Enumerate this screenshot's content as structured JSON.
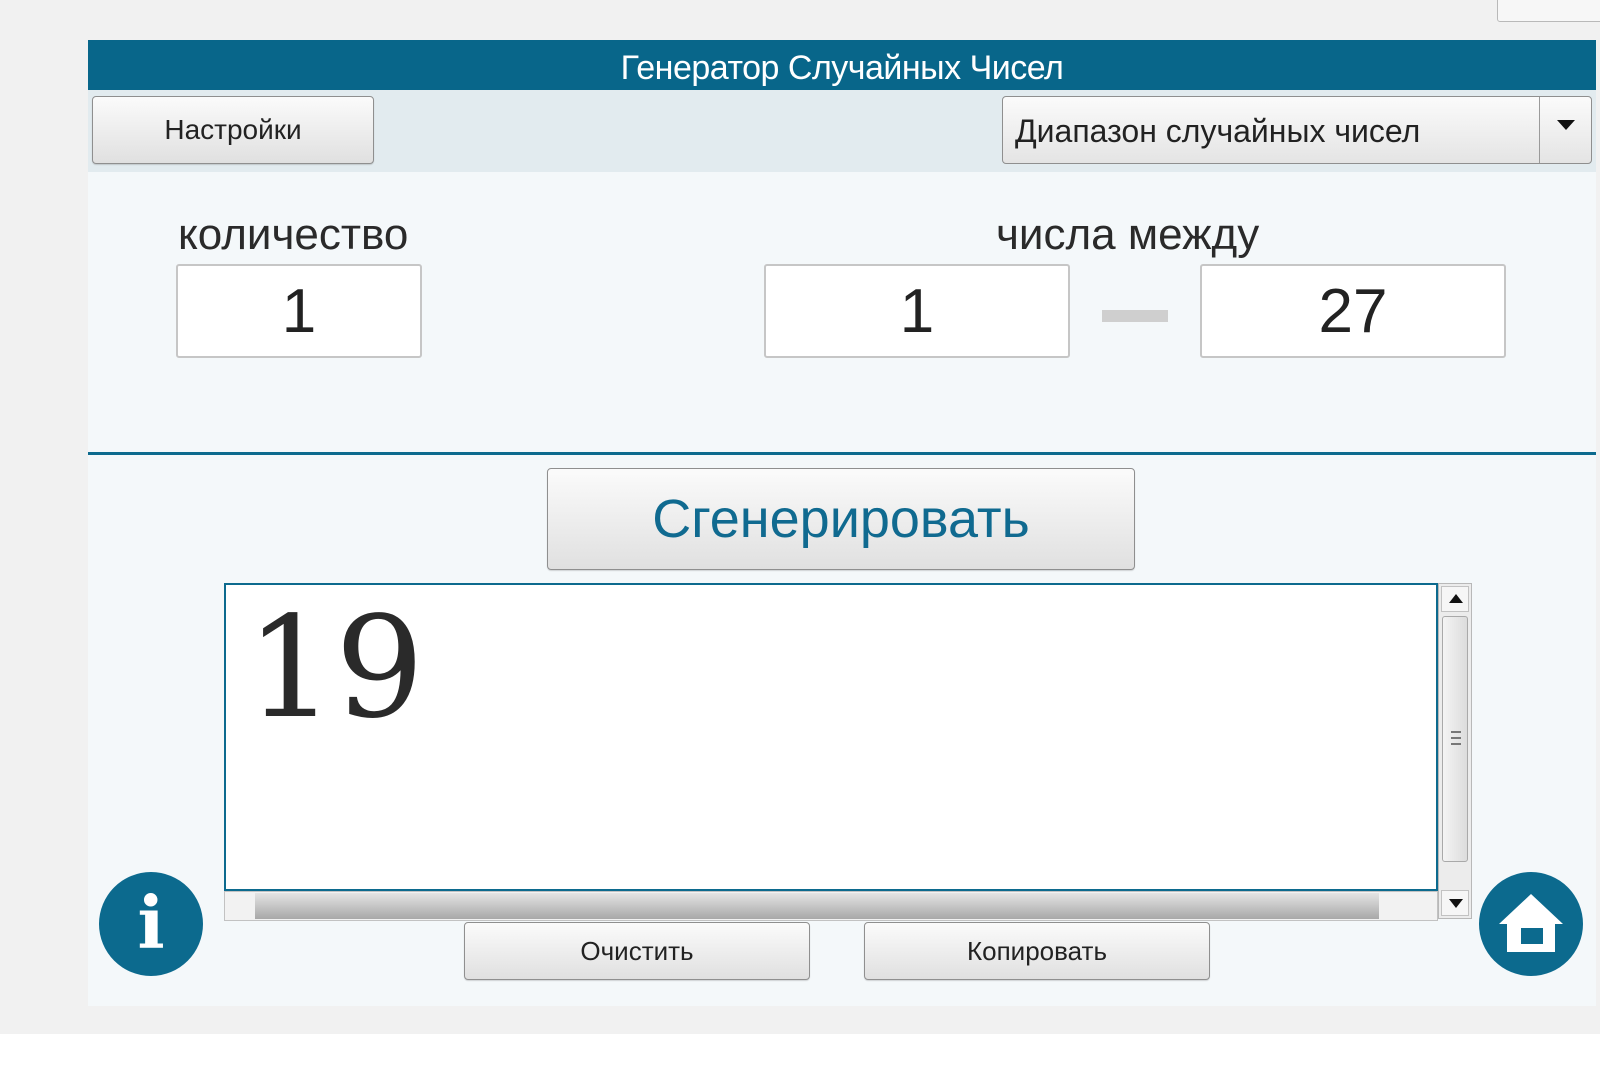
{
  "window": {
    "title": "Генератор Случайных Чисел"
  },
  "toolbar": {
    "settings_label": "Настройки",
    "mode_select_value": "Диапазон случайных чисел"
  },
  "inputs": {
    "count_label": "количество",
    "count_value": "1",
    "range_label": "числа между",
    "min_value": "1",
    "max_value": "27"
  },
  "actions": {
    "generate_label": "Сгенерировать",
    "clear_label": "Очистить",
    "copy_label": "Копировать"
  },
  "result": {
    "text": "19"
  },
  "icons": {
    "info": "info-icon",
    "home": "home-icon",
    "dropdown": "chevron-down-icon"
  },
  "colors": {
    "accent": "#08668a",
    "toolbar_bg": "#e2ebef",
    "panel_bg": "#f4f8fa"
  }
}
